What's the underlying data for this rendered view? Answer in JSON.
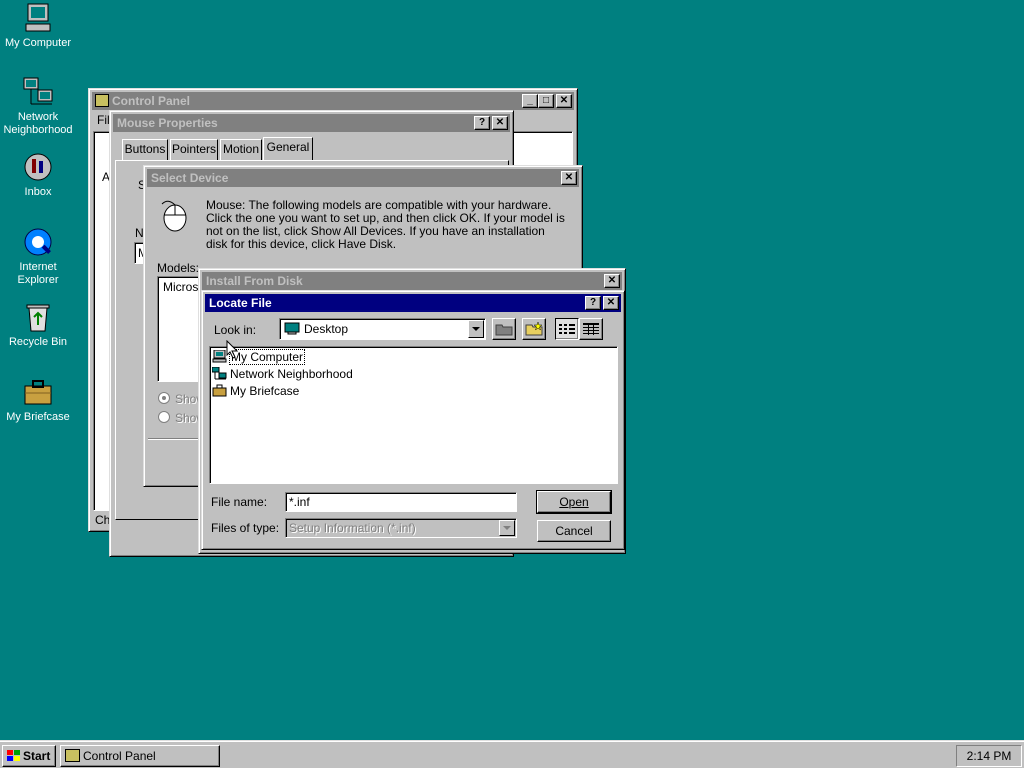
{
  "desktop": {
    "icons": [
      {
        "label": "My Computer",
        "icon": "computer-icon"
      },
      {
        "label": "Network Neighborhood",
        "icon": "network-icon"
      },
      {
        "label": "Inbox",
        "icon": "inbox-icon"
      },
      {
        "label": "Internet Explorer",
        "icon": "internet-explorer-icon"
      },
      {
        "label": "Recycle Bin",
        "icon": "recycle-bin-icon"
      },
      {
        "label": "My Briefcase",
        "icon": "briefcase-icon"
      }
    ]
  },
  "control_panel": {
    "title": "Control Panel",
    "menu_fragment": "Fil",
    "left_fragment": "A",
    "status_fragment": "Cha"
  },
  "mouse_properties": {
    "title": "Mouse Properties",
    "tabs": [
      "Buttons",
      "Pointers",
      "Motion",
      "General"
    ],
    "active_tab": "General",
    "name_fragment": "N",
    "field_fragment": "M",
    "s_fragment": "S"
  },
  "select_device": {
    "title": "Select Device",
    "description": "Mouse: The following models are compatible with your hardware. Click the one you want to set up, and then click OK. If your model is not on the list, click Show All Devices. If you have an installation disk for this device, click Have Disk.",
    "models_label": "Models:",
    "models": [
      "Microso"
    ],
    "radio1": "Show",
    "radio2": "Show"
  },
  "install_from_disk": {
    "title": "Install From Disk"
  },
  "locate_file": {
    "title": "Locate File",
    "look_in_label": "Look in:",
    "look_in_value": "Desktop",
    "items": [
      {
        "label": "My Computer",
        "icon": "computer-icon"
      },
      {
        "label": "Network Neighborhood",
        "icon": "network-icon"
      },
      {
        "label": "My Briefcase",
        "icon": "briefcase-icon"
      }
    ],
    "file_name_label": "File name:",
    "file_name_value": "*.inf",
    "files_of_type_label": "Files of type:",
    "files_of_type_value": "Setup Information (*.inf)",
    "open_label": "Open",
    "cancel_label": "Cancel"
  },
  "taskbar": {
    "start_label": "Start",
    "task_label": "Control Panel",
    "clock": "2:14 PM"
  },
  "colors": {
    "desktop": "#008080",
    "active_title": "#000080",
    "inactive_title": "#808080",
    "face": "#c0c0c0"
  }
}
